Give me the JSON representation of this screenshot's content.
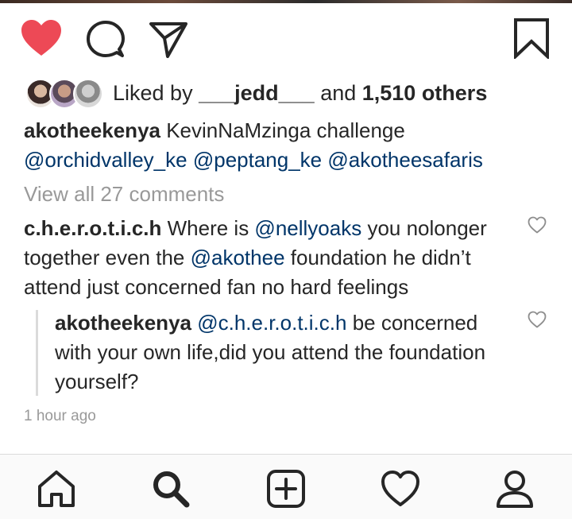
{
  "colors": {
    "like_red": "#ed4956",
    "text": "#262626",
    "mention_blue": "#003569",
    "muted": "#999999",
    "divider": "#dbdbdb"
  },
  "actions": {
    "like_icon": "heart-filled-icon",
    "comment_icon": "comment-bubble-icon",
    "share_icon": "paper-plane-icon",
    "save_icon": "bookmark-icon",
    "liked": true
  },
  "likes": {
    "prefix": "Liked by ",
    "user": "___jedd___",
    "connector": " and ",
    "others": "1,510 others"
  },
  "caption": {
    "username": "akotheekenya",
    "text": " KevinNaMzinga challenge ",
    "mentions": [
      "@orchidvalley_ke",
      "@peptang_ke",
      "@akotheesafaris"
    ]
  },
  "view_all_comments": "View all 27 comments",
  "comment": {
    "username": "c.h.e.r.o.t.i.c.h",
    "part1": " Where is ",
    "mention1": "@nellyoaks",
    "part2": " you nolonger together even the ",
    "mention2": "@akothee",
    "part3": " foundation he didn’t attend just concerned fan no hard feelings"
  },
  "reply": {
    "username": "akotheekenya",
    "mention": "@c.h.e.r.o.t.i.c.h",
    "text": " be concerned with your own life,did you attend the foundation yourself?"
  },
  "timestamp": "1 hour ago",
  "bottom_nav": {
    "items": [
      "home-icon",
      "search-icon",
      "new-post-icon",
      "activity-heart-icon",
      "profile-icon"
    ],
    "active": "search-icon"
  }
}
